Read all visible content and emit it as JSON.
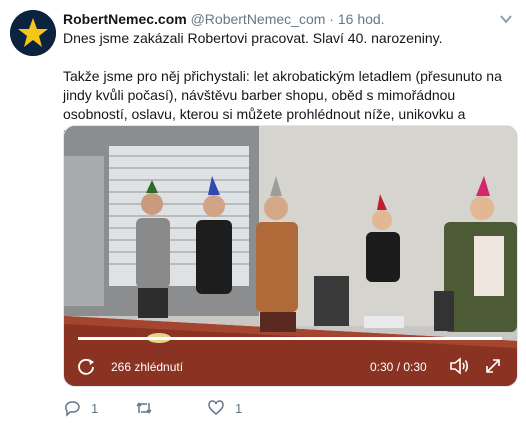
{
  "tweet": {
    "author_name": "RobertNemec.com",
    "handle": "@RobertNemec_com",
    "separator": "·",
    "time": "16 hod.",
    "text_line1": "Dnes jsme zakázali Robertovi pracovat. Slaví 40. narozeniny.",
    "text_para2": "Takže jsme pro něj přichystali: let akrobatickým letadlem (přesunuto na jindy kvůli počasí), návštěvu barber shopu, oběd s mimořádnou osobností, oslavu, kterou si můžete prohlédnout níže, unikovku a posezení v hospodě."
  },
  "video": {
    "views": "266 zhlédnutí",
    "time": "0:30 / 0:30",
    "progress": 1.0,
    "icons": [
      "replay-icon",
      "volume-icon",
      "fullscreen-icon"
    ]
  },
  "actions": {
    "reply_count": "1",
    "retweet_count": "",
    "like_count": "1",
    "icons": [
      "reply-icon",
      "retweet-icon",
      "like-icon"
    ]
  },
  "colors": {
    "text": "#14171a",
    "secondary": "#657786",
    "avatar_bg": "#0c2340",
    "avatar_star": "#f5c518"
  }
}
